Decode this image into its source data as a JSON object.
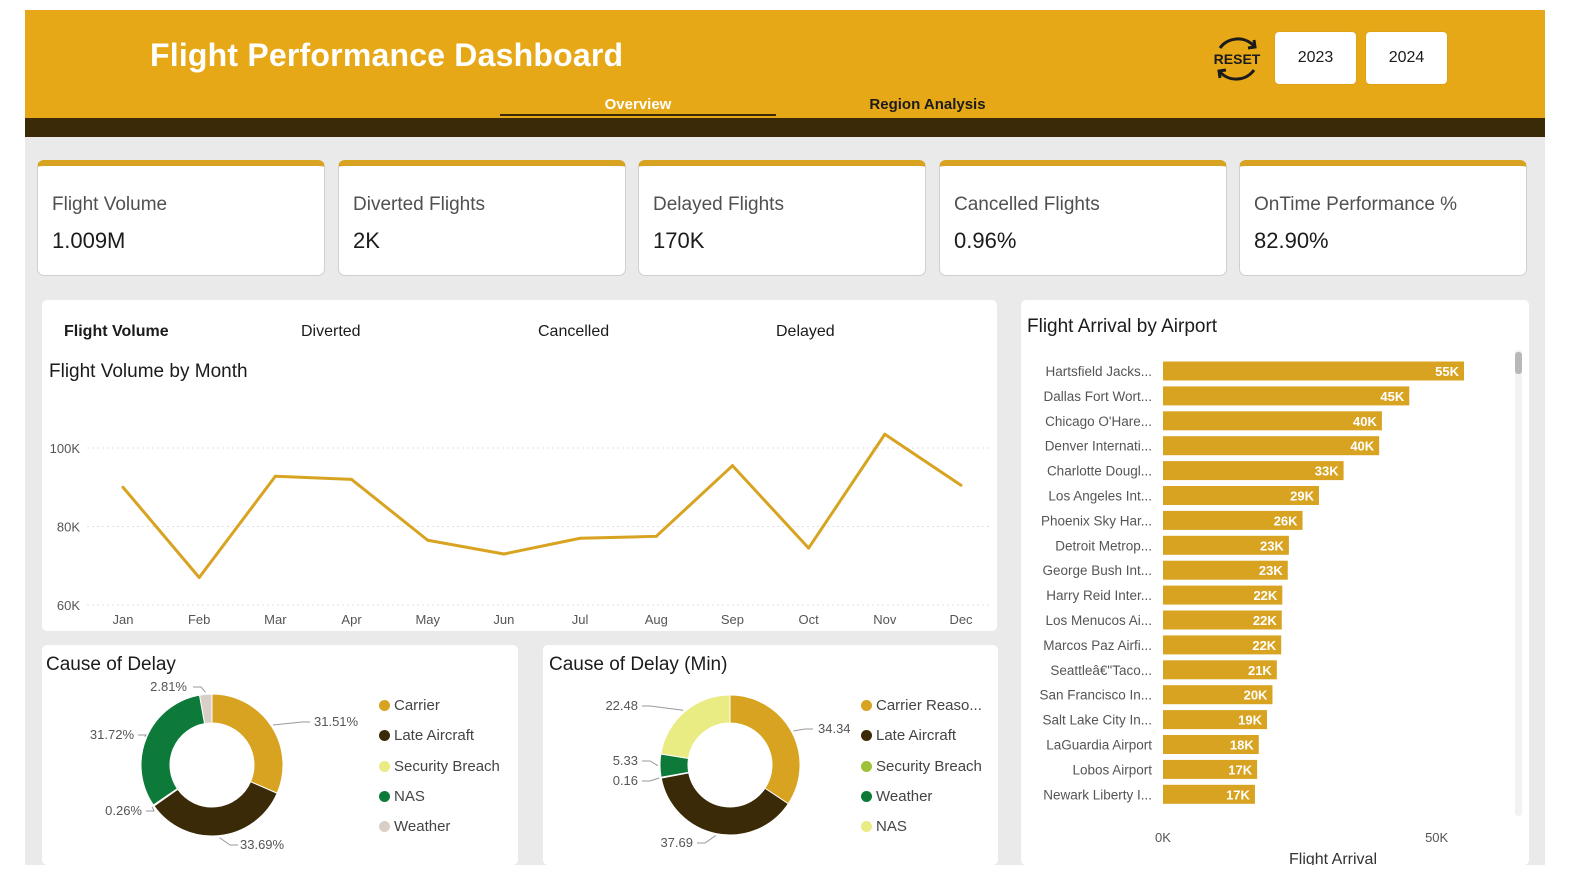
{
  "header": {
    "title": "Flight Performance Dashboard",
    "tabs": [
      {
        "label": "Overview",
        "active": true
      },
      {
        "label": "Region Analysis",
        "active": false
      }
    ],
    "reset_label": "RESET",
    "years": [
      "2023",
      "2024"
    ],
    "colors": {
      "header_bg": "#e6a817",
      "band": "#3b2a07"
    }
  },
  "kpis": [
    {
      "label": "Flight Volume",
      "value": "1.009M"
    },
    {
      "label": "Diverted Flights",
      "value": "2K"
    },
    {
      "label": "Delayed Flights",
      "value": "170K"
    },
    {
      "label": "Cancelled Flights",
      "value": "0.96%"
    },
    {
      "label": "OnTime Performance %",
      "value": "82.90%"
    }
  ],
  "metric_tabs": [
    "Flight Volume",
    "Diverted",
    "Cancelled",
    "Delayed"
  ],
  "chart_data": [
    {
      "type": "line",
      "title": "Flight Volume by Month",
      "categories": [
        "Jan",
        "Feb",
        "Mar",
        "Apr",
        "May",
        "Jun",
        "Jul",
        "Aug",
        "Sep",
        "Oct",
        "Nov",
        "Dec"
      ],
      "values": [
        90000,
        67000,
        92800,
        92000,
        76500,
        73000,
        77000,
        77500,
        95500,
        74500,
        103500,
        90500
      ],
      "yticks": [
        "60K",
        "80K",
        "100K"
      ],
      "ylim": [
        60000,
        100000
      ],
      "color": "#d8a320",
      "grid": true
    },
    {
      "type": "pie",
      "title": "Cause of Delay",
      "labels": [
        "Carrier",
        "Late Aircraft",
        "Security Breach",
        "NAS",
        "Weather"
      ],
      "values": [
        31.51,
        33.69,
        0.26,
        31.72,
        2.81
      ],
      "data_labels": [
        "31.51%",
        "33.69%",
        "0.26%",
        "31.72%",
        "2.81%"
      ],
      "colors": [
        "#d8a320",
        "#3b2a07",
        "#e8ec82",
        "#0d7a3a",
        "#d9cfc6"
      ],
      "legend": "right"
    },
    {
      "type": "pie",
      "title": "Cause of Delay (Min)",
      "labels": [
        "Carrier Reaso...",
        "Late Aircraft",
        "Security Breach",
        "Weather",
        "NAS"
      ],
      "values": [
        34.34,
        37.69,
        0.16,
        5.33,
        22.48
      ],
      "data_labels": [
        "34.34",
        "37.69",
        "0.16",
        "5.33",
        "22.48"
      ],
      "colors": [
        "#d8a320",
        "#3b2a07",
        "#9dc23a",
        "#0d7a3a",
        "#e8ec82"
      ],
      "legend": "right"
    },
    {
      "type": "bar",
      "title": "Flight Arrival by Airport",
      "categories": [
        "Hartsfield Jacks...",
        "Dallas Fort Wort...",
        "Chicago O'Hare...",
        "Denver Internati...",
        "Charlotte Dougl...",
        "Los Angeles Int...",
        "Phoenix Sky Har...",
        "Detroit Metrop...",
        "George Bush Int...",
        "Harry Reid Inter...",
        "Los Menucos Ai...",
        "Marcos Paz Airfi...",
        "Seattleâ€\"Taco...",
        "San Francisco In...",
        "Salt Lake City In...",
        "LaGuardia Airport",
        "Lobos Airport",
        "Newark Liberty I..."
      ],
      "values": [
        55000,
        45000,
        40000,
        39500,
        33000,
        28500,
        25500,
        23000,
        22800,
        21800,
        21700,
        21600,
        20800,
        20000,
        19000,
        17500,
        17200,
        16800
      ],
      "data_labels": [
        "55K",
        "45K",
        "40K",
        "40K",
        "33K",
        "29K",
        "26K",
        "23K",
        "23K",
        "22K",
        "22K",
        "22K",
        "21K",
        "20K",
        "19K",
        "18K",
        "17K",
        "17K"
      ],
      "xticks": [
        "0K",
        "50K"
      ],
      "xlabel": "Flight Arrival",
      "xlim": [
        0,
        50000
      ],
      "color": "#d8a320"
    }
  ]
}
